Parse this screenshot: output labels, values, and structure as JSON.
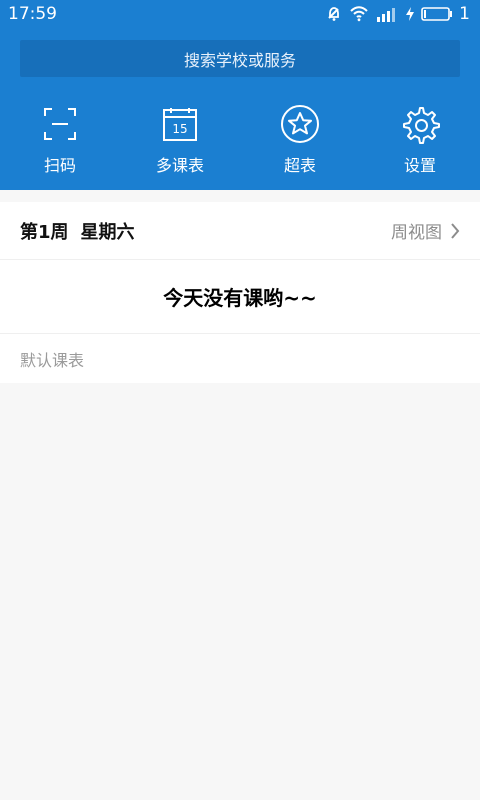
{
  "status_bar": {
    "time": "17:59",
    "battery_text": "1"
  },
  "search": {
    "placeholder": "搜索学校或服务"
  },
  "toolbar": {
    "items": [
      {
        "label": "扫码",
        "icon": "scan-icon"
      },
      {
        "label": "多课表",
        "icon": "calendar-icon"
      },
      {
        "label": "超表",
        "icon": "star-icon"
      },
      {
        "label": "设置",
        "icon": "gear-icon"
      }
    ]
  },
  "schedule": {
    "week": "第1周",
    "weekday": "星期六",
    "view_label": "周视图",
    "empty_message": "今天没有课哟~~",
    "default_label": "默认课表"
  },
  "colors": {
    "primary": "#1b7fd1",
    "background": "#f7f7f7",
    "muted_text": "#8c8c8c"
  }
}
